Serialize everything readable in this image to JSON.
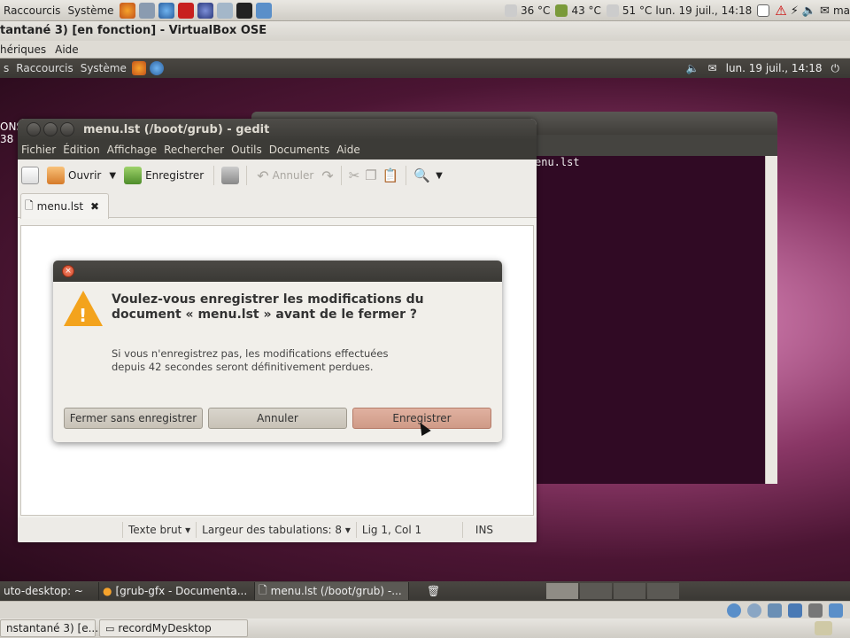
{
  "host_panel": {
    "menus": [
      "Raccourcis",
      "Système"
    ],
    "temps": [
      "36 °C",
      "43 °C",
      "51 °C"
    ],
    "clock": "lun. 19 juil., 14:18",
    "user": "ma"
  },
  "vbox": {
    "title": "tantané 3) [en fonction] - VirtualBox OSE",
    "menus": [
      "hériques",
      "Aide"
    ]
  },
  "guest_panel": {
    "menus": [
      "s",
      "Raccourcis",
      "Système"
    ],
    "clock": "lun. 19 juil., 14:18"
  },
  "desktop_left": {
    "line1": "ONS",
    "line2": "38"
  },
  "terminal": {
    "text": "enu.lst"
  },
  "gedit": {
    "title": "menu.lst (/boot/grub) - gedit",
    "menus": [
      "Fichier",
      "Édition",
      "Affichage",
      "Rechercher",
      "Outils",
      "Documents",
      "Aide"
    ],
    "toolbar": {
      "open": "Ouvrir",
      "save": "Enregistrer",
      "undo": "Annuler"
    },
    "tab_label": "menu.lst",
    "statusbar": {
      "mode": "Texte brut",
      "tabwidth": "Largeur des tabulations:  8",
      "position": "Lig 1, Col 1",
      "ins": "INS"
    }
  },
  "dialog": {
    "heading": "Voulez-vous enregistrer les modifications du document « menu.lst » avant de le fermer ?",
    "body": "Si vous n'enregistrez pas, les modifications effectuées depuis 42 secondes seront définitivement perdues.",
    "btn_close_nosave": "Fermer sans enregistrer",
    "btn_cancel": "Annuler",
    "btn_save": "Enregistrer"
  },
  "guest_taskbar": {
    "tasks": [
      "uto-desktop: ~",
      "[grub-gfx - Documenta...",
      "menu.lst (/boot/grub) -..."
    ]
  },
  "host_taskbar": {
    "tasks": [
      "nstantané 3) [e...",
      "recordMyDesktop"
    ]
  },
  "colors": {
    "accent_warning": "#f3a31d",
    "terminal_bg": "#300a24"
  }
}
